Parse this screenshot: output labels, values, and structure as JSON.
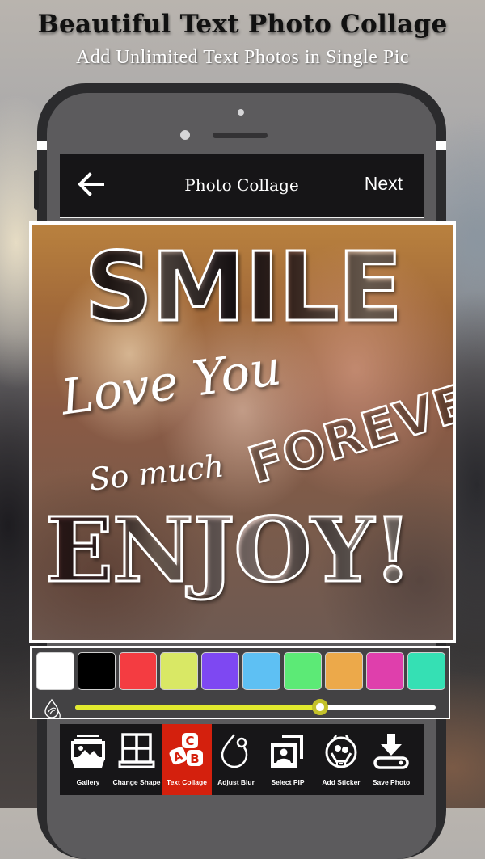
{
  "promo": {
    "title": "Beautiful Text Photo Collage",
    "subtitle": "Add Unlimited Text Photos in Single Pic"
  },
  "appbar": {
    "back_icon": "arrow-left-icon",
    "title": "Photo Collage",
    "next_label": "Next"
  },
  "collage": {
    "texts": {
      "smile": "SMILE",
      "love_you": "Love You",
      "so_much": "So much",
      "forever": "FOREVER",
      "enjoy": "ENJOY!"
    }
  },
  "palette": {
    "colors": [
      "#ffffff",
      "#000000",
      "#f43c41",
      "#d9e865",
      "#7e48f2",
      "#5ec0f3",
      "#5cea76",
      "#eca94a",
      "#df3fac",
      "#35e0b4"
    ],
    "opacity_icon": "opacity-drop-icon",
    "slider": {
      "value_percent": 68,
      "fill_color": "#e2ea2e",
      "thumb_color": "#c3c12a"
    }
  },
  "toolbar": {
    "active_color": "#d4200d",
    "items": [
      {
        "label": "Gallery",
        "icon": "gallery-icon",
        "active": false
      },
      {
        "label": "Change Shape",
        "icon": "window-grid-icon",
        "active": false
      },
      {
        "label": "Text Collage",
        "icon": "abc-blocks-icon",
        "active": true
      },
      {
        "label": "Adjust Blur",
        "icon": "blur-drop-icon",
        "active": false
      },
      {
        "label": "Select PIP",
        "icon": "pip-photo-icon",
        "active": false
      },
      {
        "label": "Add Sticker",
        "icon": "sticker-face-icon",
        "active": false
      },
      {
        "label": "Save Photo",
        "icon": "download-icon",
        "active": false
      }
    ]
  }
}
